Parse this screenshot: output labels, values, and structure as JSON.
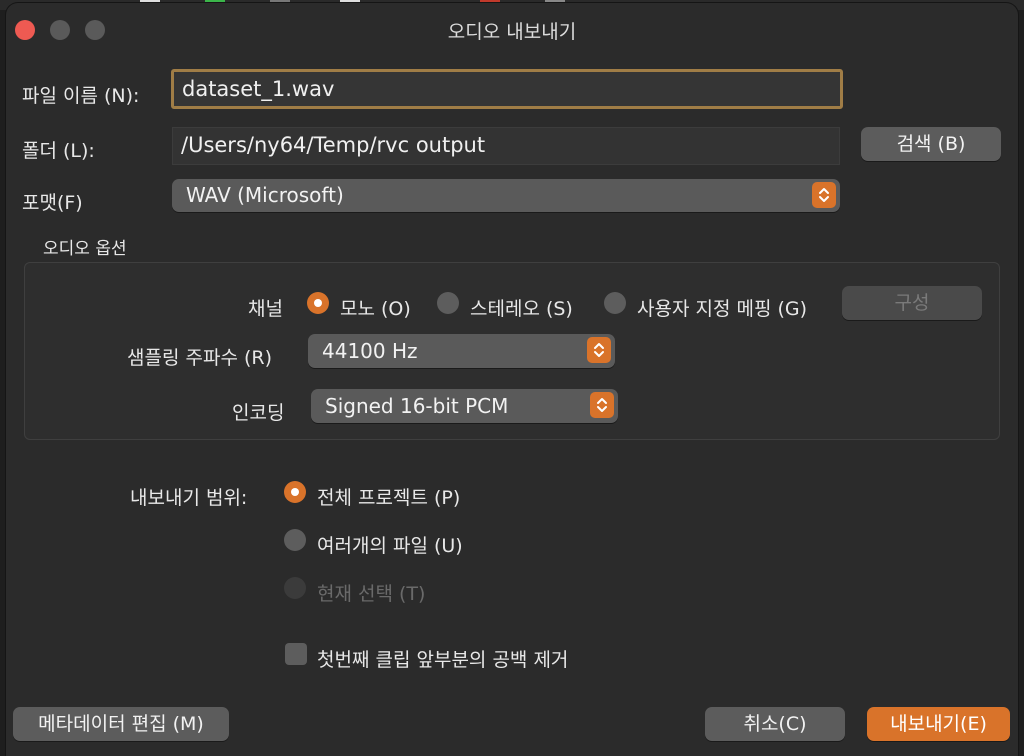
{
  "window": {
    "title": "오디오 내보내기"
  },
  "file_name": {
    "label": "파일 이름 (N):",
    "value": "dataset_1.wav"
  },
  "folder": {
    "label": "폴더 (L):",
    "value": "/Users/ny64/Temp/rvc output",
    "browse_label": "검색 (B)"
  },
  "format": {
    "label": "포맷(F)",
    "value": "WAV (Microsoft)"
  },
  "audio_options": {
    "title": "오디오 옵션",
    "channel_label": "채널",
    "channels": [
      {
        "label": "모노 (O)",
        "selected": true
      },
      {
        "label": "스테레오 (S)",
        "selected": false
      },
      {
        "label": "사용자 지정 메핑 (G)",
        "selected": false
      }
    ],
    "configure_label": "구성",
    "sample_rate_label": "샘플링 주파수 (R)",
    "sample_rate_value": "44100 Hz",
    "encoding_label": "인코딩",
    "encoding_value": "Signed 16-bit PCM"
  },
  "export_range": {
    "label": "내보내기 범위:",
    "options": [
      {
        "label": "전체 프로젝트 (P)",
        "selected": true,
        "enabled": true
      },
      {
        "label": "여러개의 파일 (U)",
        "selected": false,
        "enabled": true
      },
      {
        "label": "현재 선택 (T)",
        "selected": false,
        "enabled": false
      }
    ]
  },
  "trim_silence": {
    "label": "첫번째 클립 앞부분의 공백 제거",
    "checked": false
  },
  "footer": {
    "metadata_label": "메타데이터 편집 (M)",
    "cancel_label": "취소(C)",
    "export_label": "내보내기(E)"
  },
  "colors": {
    "accent": "#d9732a",
    "window_bg": "#2b2b2b",
    "close": "#ee5a52"
  }
}
